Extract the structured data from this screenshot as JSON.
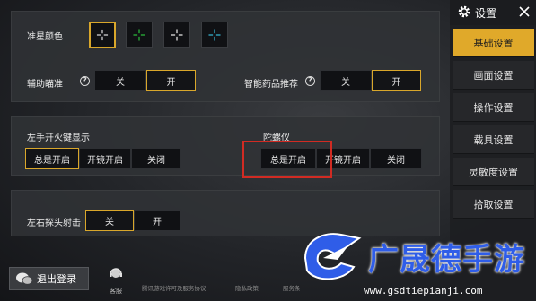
{
  "crosshair": {
    "label": "准星颜色",
    "options": [
      {
        "name": "white",
        "color": "#ffffff",
        "selected": true
      },
      {
        "name": "green",
        "color": "#2ecc40",
        "selected": false
      },
      {
        "name": "white",
        "color": "#ffffff",
        "selected": false
      },
      {
        "name": "cyan",
        "color": "#39c6e6",
        "selected": false
      }
    ]
  },
  "aim_assist": {
    "label": "辅助瞄准",
    "help": "?",
    "options": [
      "关",
      "开"
    ],
    "selected": 1
  },
  "smart_medicine": {
    "label": "智能药品推荐",
    "help": "?",
    "options": [
      "关",
      "开"
    ],
    "selected": 1
  },
  "left_fire": {
    "label": "左手开火键显示",
    "options": [
      "总是开启",
      "开镜开启",
      "关闭"
    ],
    "selected": 0
  },
  "gyroscope": {
    "label": "陀螺仪",
    "options": [
      "总是开启",
      "开镜开启",
      "关闭"
    ],
    "selected": -1
  },
  "peek_fire": {
    "label": "左右探头射击",
    "options": [
      "关",
      "开"
    ],
    "selected": 0
  },
  "sidebar": {
    "title": "设置",
    "items": [
      {
        "label": "基础设置",
        "active": true
      },
      {
        "label": "画面设置",
        "active": false
      },
      {
        "label": "操作设置",
        "active": false
      },
      {
        "label": "载具设置",
        "active": false
      },
      {
        "label": "灵敏度设置",
        "active": false
      },
      {
        "label": "拾取设置",
        "active": false
      }
    ]
  },
  "footer": {
    "logout": "退出登录",
    "service": "客服",
    "links": [
      "腾讯游戏许可及服务协议",
      "隐私政策",
      "服务条"
    ]
  },
  "watermark": {
    "text": "广晟德手游",
    "url": "www.gsdtiepianji.com"
  },
  "colors": {
    "accent": "#e0a92a",
    "highlight": "#d12b23",
    "watermark": "#2f5de8"
  }
}
